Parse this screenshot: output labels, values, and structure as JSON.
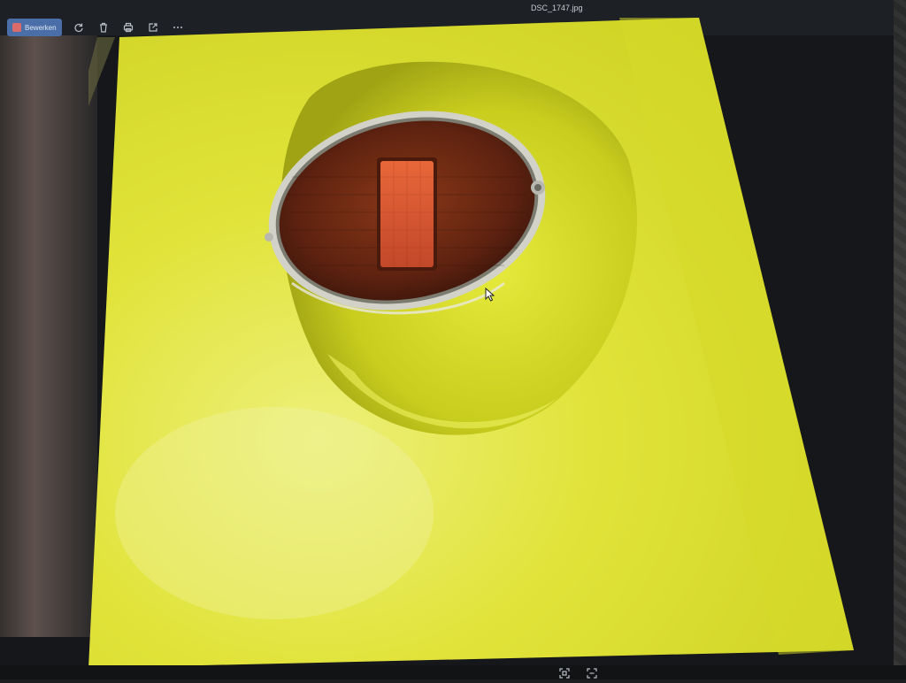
{
  "window": {
    "title": "DSC_1747.jpg"
  },
  "toolbar": {
    "edit_label": "Bewerken",
    "icons": [
      "rotate-icon",
      "delete-icon",
      "print-icon",
      "share-icon",
      "more-icon"
    ]
  },
  "statusbar": {
    "icons": [
      "fit-to-window-icon",
      "fullscreen-icon"
    ]
  },
  "colors": {
    "photo_yellow": "#e4e63a",
    "taillight_red": "#7a2c14",
    "reflector_orange": "#d9562f",
    "chrome": "#c8c8c0"
  }
}
